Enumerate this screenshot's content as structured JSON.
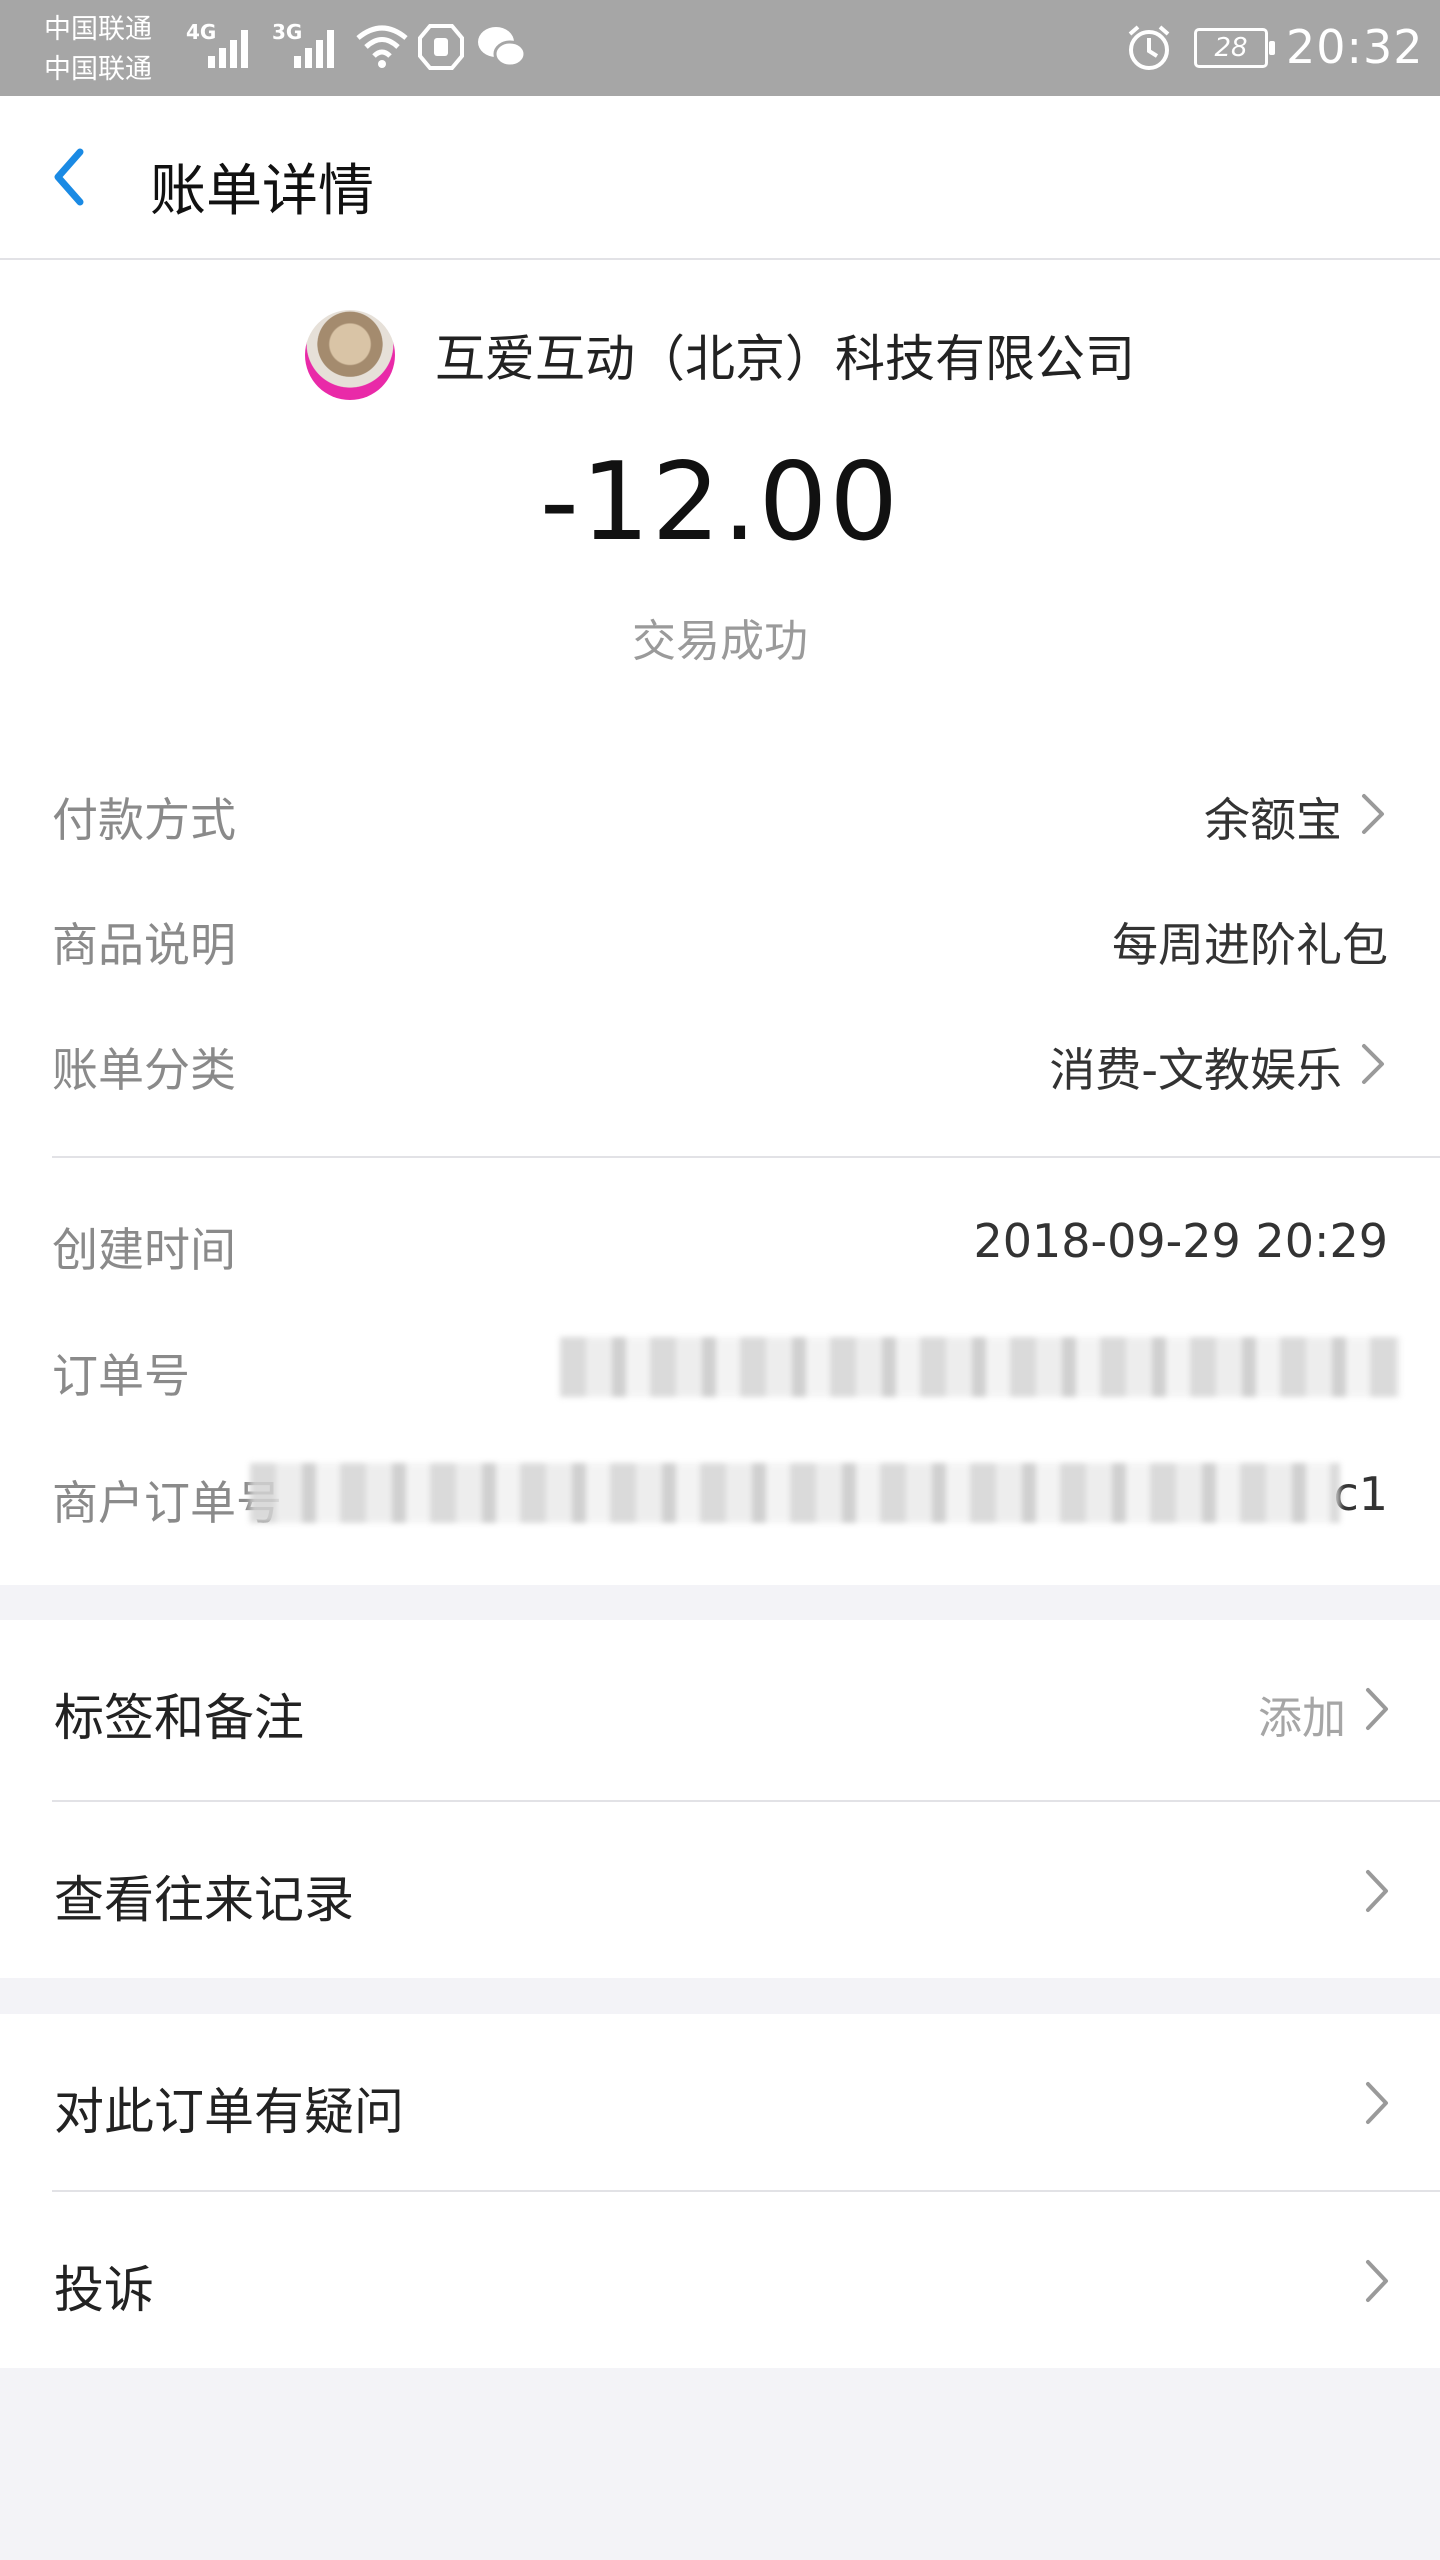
{
  "status_bar": {
    "carrier_1": "中国联通",
    "carrier_2": "中国联通",
    "network_1": "4G",
    "network_2": "3G",
    "battery": "28",
    "time": "20:32"
  },
  "nav": {
    "title": "账单详情"
  },
  "summary": {
    "merchant_name": "互爱互动（北京）科技有限公司",
    "amount": "-12.00",
    "status": "交易成功"
  },
  "details": [
    {
      "label": "付款方式",
      "value": "余额宝"
    },
    {
      "label": "商品说明",
      "value": "每周进阶礼包"
    },
    {
      "label": "账单分类",
      "value": "消费-文教娱乐"
    }
  ],
  "meta": [
    {
      "label": "创建时间",
      "value": "2018-09-29 20:29"
    },
    {
      "label": "订单号",
      "value": ""
    },
    {
      "label": "商户订单号",
      "value": "c1"
    }
  ],
  "actions_1": [
    {
      "label": "标签和备注",
      "hint": "添加"
    },
    {
      "label": "查看往来记录",
      "hint": ""
    }
  ],
  "actions_2": [
    {
      "label": "对此订单有疑问"
    },
    {
      "label": "投诉"
    }
  ],
  "colors": {
    "accent": "#1a8ae4",
    "status_bar_bg": "#a6a6a6",
    "page_bg": "#f3f3f7"
  }
}
